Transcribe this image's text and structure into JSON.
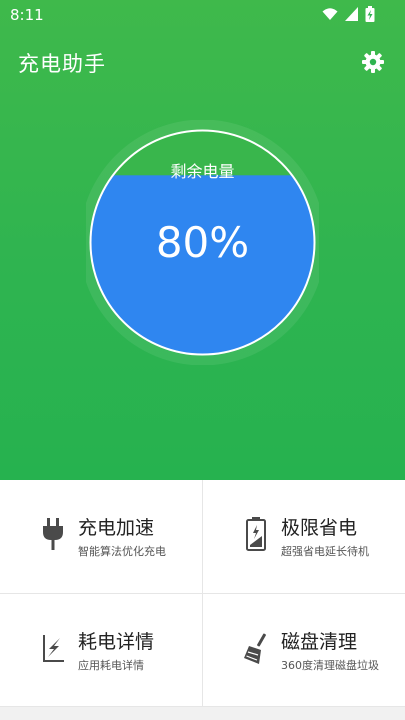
{
  "status_bar": {
    "time": "8:11",
    "icons": [
      "wifi-icon",
      "signal-icon",
      "battery-charging-icon"
    ]
  },
  "header": {
    "title": "充电助手",
    "settings_icon": "gear-icon"
  },
  "gauge": {
    "title": "剩余电量",
    "value_text": "80%",
    "level": 0.8,
    "fill_color": "#2f86f0",
    "ring_color": "#ffffff"
  },
  "features": [
    {
      "title": "充电加速",
      "subtitle": "智能算法优化充电",
      "icon": "plug-icon"
    },
    {
      "title": "极限省电",
      "subtitle": "超强省电延长待机",
      "icon": "battery-saver-icon"
    },
    {
      "title": "耗电详情",
      "subtitle": "应用耗电详情",
      "icon": "power-chart-icon"
    },
    {
      "title": "磁盘清理",
      "subtitle": "360度清理磁盘垃圾",
      "icon": "broom-icon"
    }
  ],
  "colors": {
    "primary": "#2fb450",
    "accent": "#2f86f0"
  }
}
